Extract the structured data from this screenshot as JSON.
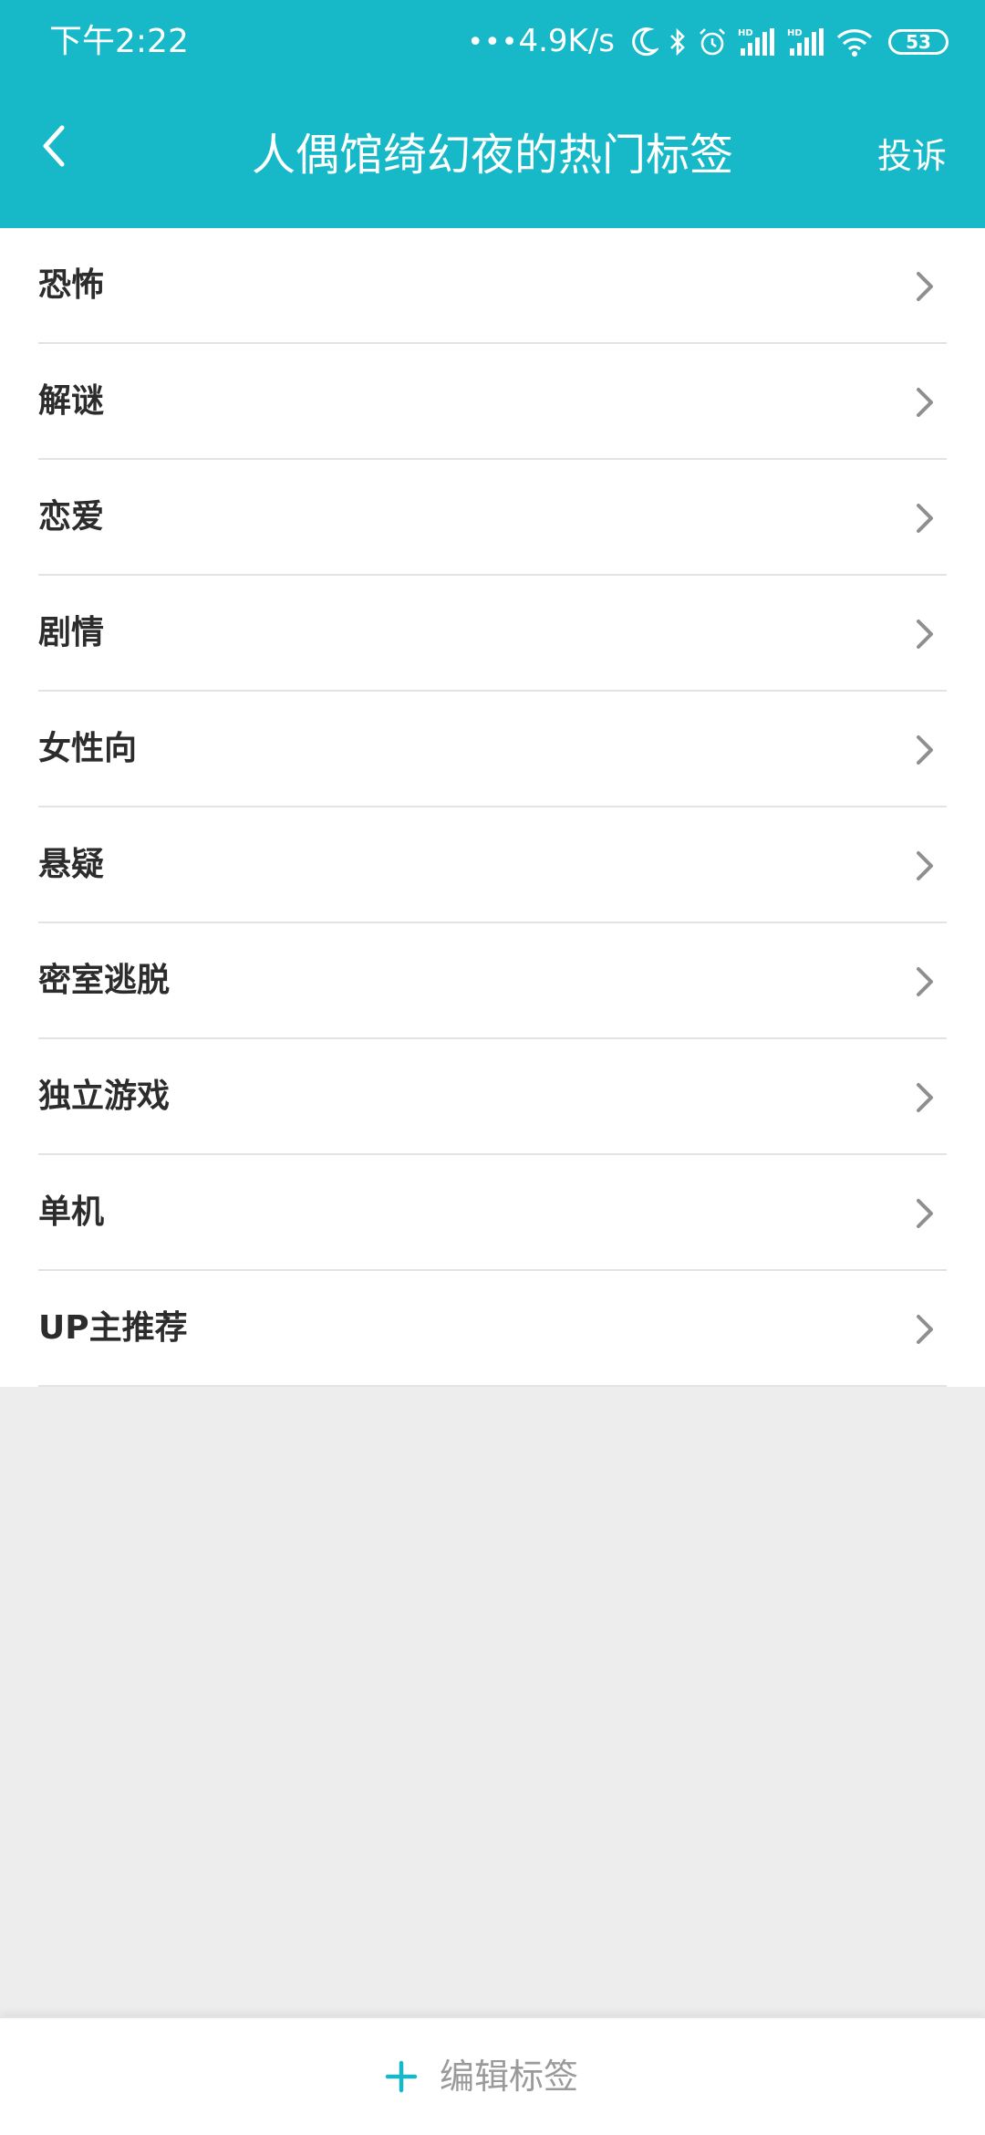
{
  "status_bar": {
    "time": "下午2:22",
    "net_dots": "•••",
    "net_speed": "4.9K/s",
    "battery": "53",
    "icons": [
      "moon-icon",
      "bluetooth-icon",
      "alarm-icon",
      "signal-hd-icon",
      "signal-hd-icon",
      "wifi-icon",
      "battery-icon"
    ]
  },
  "header": {
    "title": "人偶馆绮幻夜的热门标签",
    "action_label": "投诉",
    "back_icon": "back-arrow-icon"
  },
  "tags": [
    {
      "label": "恐怖"
    },
    {
      "label": "解谜"
    },
    {
      "label": "恋爱"
    },
    {
      "label": "剧情"
    },
    {
      "label": "女性向"
    },
    {
      "label": "悬疑"
    },
    {
      "label": "密室逃脱"
    },
    {
      "label": "独立游戏"
    },
    {
      "label": "单机"
    },
    {
      "label": "UP主推荐"
    }
  ],
  "footer": {
    "edit_label": "编辑标签",
    "edit_icon": "plus-icon"
  },
  "colors": {
    "accent": "#17b9c9",
    "background": "#ededed",
    "text": "#2c2c2c",
    "muted": "#9a9a9a"
  }
}
